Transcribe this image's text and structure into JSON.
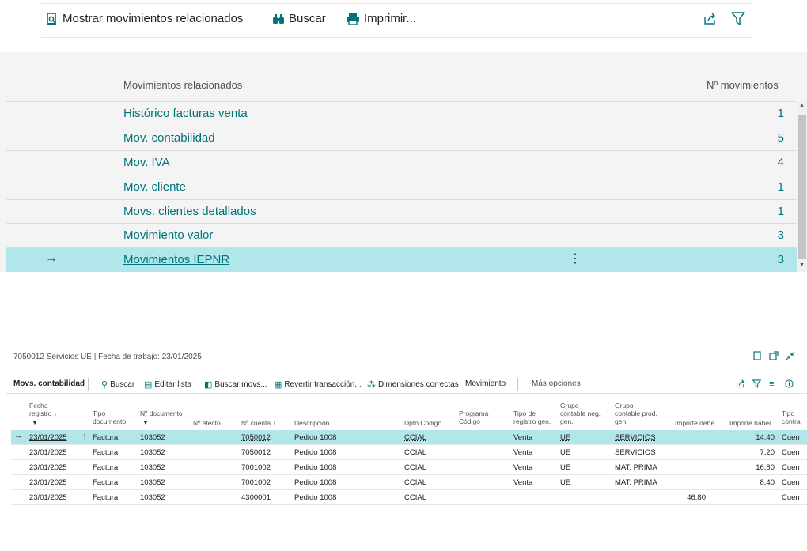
{
  "top_toolbar": {
    "show_related": "Mostrar movimientos relacionados",
    "search": "Buscar",
    "print": "Imprimir..."
  },
  "related": {
    "header_label": "Movimientos relacionados",
    "header_count": "Nº movimientos",
    "rows": [
      {
        "label": "Histórico facturas venta",
        "count": "1"
      },
      {
        "label": "Mov. contabilidad",
        "count": "5"
      },
      {
        "label": "Mov. IVA",
        "count": "4"
      },
      {
        "label": "Mov. cliente",
        "count": "1"
      },
      {
        "label": "Movs. clientes detallados",
        "count": "1"
      },
      {
        "label": "Movimiento valor",
        "count": "3"
      },
      {
        "label": "Movimientos IEPNR",
        "count": "3"
      }
    ],
    "selected_arrow": "→",
    "dots": "⋮"
  },
  "page": {
    "caption": "7050012 Servicios UE | Fecha de trabajo: 23/01/2025"
  },
  "bottom_toolbar": {
    "title": "Movs. contabilidad",
    "search": "Buscar",
    "edit_list": "Editar lista",
    "find_entries": "Buscar movs...",
    "reverse": "Revertir transacción...",
    "dimensions": "Dimensiones correctas",
    "movement": "Movimiento",
    "more": "Más opciones"
  },
  "grid": {
    "headers": {
      "fecha": "Fecha registro ↓",
      "tipo_doc": "Tipo documento",
      "n_doc": "Nº documento",
      "n_efecto": "Nº efecto",
      "n_cuenta": "Nº cuenta ↓",
      "descripcion": "Descripción",
      "dpto": "Dpto Código",
      "programa": "Programa Código",
      "tipo_reg": "Tipo de registro gen.",
      "grupo_neg": "Grupo contable neg. gen.",
      "grupo_prod": "Grupo contable prod. gen.",
      "importe_debe": "Importe debe",
      "importe_haber": "Importe haber",
      "tipo_contra": "Tipo contra"
    },
    "rows": [
      {
        "fecha": "23/01/2025",
        "tipo": "Factura",
        "doc": "103052",
        "cuenta": "7050012",
        "desc": "Pedido 1008",
        "dpto": "CCIAL",
        "tipo_reg": "Venta",
        "neg": "UE",
        "prod": "SERVICIOS",
        "debe": "",
        "haber": "14,40",
        "contra": "Cuen"
      },
      {
        "fecha": "23/01/2025",
        "tipo": "Factura",
        "doc": "103052",
        "cuenta": "7050012",
        "desc": "Pedido 1008",
        "dpto": "CCIAL",
        "tipo_reg": "Venta",
        "neg": "UE",
        "prod": "SERVICIOS",
        "debe": "",
        "haber": "7,20",
        "contra": "Cuen"
      },
      {
        "fecha": "23/01/2025",
        "tipo": "Factura",
        "doc": "103052",
        "cuenta": "7001002",
        "desc": "Pedido 1008",
        "dpto": "CCIAL",
        "tipo_reg": "Venta",
        "neg": "UE",
        "prod": "MAT. PRIMA",
        "debe": "",
        "haber": "16,80",
        "contra": "Cuen"
      },
      {
        "fecha": "23/01/2025",
        "tipo": "Factura",
        "doc": "103052",
        "cuenta": "7001002",
        "desc": "Pedido 1008",
        "dpto": "CCIAL",
        "tipo_reg": "Venta",
        "neg": "UE",
        "prod": "MAT. PRIMA",
        "debe": "",
        "haber": "8,40",
        "contra": "Cuen"
      },
      {
        "fecha": "23/01/2025",
        "tipo": "Factura",
        "doc": "103052",
        "cuenta": "4300001",
        "desc": "Pedido 1008",
        "dpto": "CCIAL",
        "tipo_reg": "",
        "neg": "",
        "prod": "",
        "debe": "46,80",
        "haber": "",
        "contra": "Cuen"
      }
    ]
  },
  "colors": {
    "accent": "#00747a",
    "selected_row": "#b1e6ea",
    "panel_bg": "#f4f4f4"
  },
  "icons": [
    "document-search-icon",
    "binoculars-icon",
    "printer-icon",
    "share-icon",
    "filter-icon",
    "bookmark-icon",
    "open-new-icon",
    "collapse-icon",
    "search-icon",
    "edit-list-icon",
    "find-entries-icon",
    "reverse-icon",
    "dimensions-icon",
    "list-icon",
    "info-icon"
  ]
}
